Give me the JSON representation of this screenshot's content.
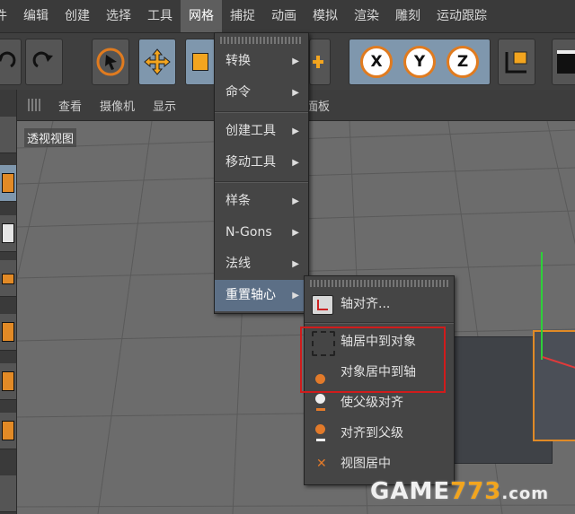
{
  "menubar": {
    "items": [
      "件",
      "编辑",
      "创建",
      "选择",
      "工具",
      "网格",
      "捕捉",
      "动画",
      "模拟",
      "渲染",
      "雕刻",
      "运动跟踪"
    ],
    "active_index": 5
  },
  "toolbar": {
    "axis_buttons": [
      "X",
      "Y",
      "Z"
    ]
  },
  "viewport": {
    "menu": [
      "查看",
      "摄像机",
      "显示",
      "面板"
    ],
    "label": "透视视图"
  },
  "mesh_menu": {
    "items": [
      {
        "label": "转换",
        "arrow": "▶"
      },
      {
        "label": "命令",
        "arrow": "▶"
      },
      {
        "label": "创建工具",
        "arrow": "▶"
      },
      {
        "label": "移动工具",
        "arrow": "▶"
      },
      {
        "label": "样条",
        "arrow": "▶"
      },
      {
        "label": "N-Gons",
        "arrow": "▶"
      },
      {
        "label": "法线",
        "arrow": "▶"
      },
      {
        "label": "重置轴心",
        "arrow": "▶"
      }
    ],
    "highlighted_index": 7
  },
  "pivot_submenu": {
    "items": [
      {
        "label": "轴对齐...",
        "icon": "axis-align-icon"
      },
      {
        "label": "轴居中到对象",
        "icon": "axis-center-icon"
      },
      {
        "label": "对象居中到轴",
        "icon": "object-center-icon"
      },
      {
        "label": "使父级对齐",
        "icon": "parent-align-icon"
      },
      {
        "label": "对齐到父级",
        "icon": "align-to-parent-icon"
      },
      {
        "label": "视图居中",
        "icon": "view-center-icon"
      }
    ]
  },
  "watermark": {
    "a": "GAME",
    "b": "773",
    ".com": ".com"
  },
  "colors": {
    "accent": "#e07b1f",
    "highlight": "#5c6f86",
    "redbox": "#d01c1c",
    "toolbar_blue": "#7f97ad"
  }
}
